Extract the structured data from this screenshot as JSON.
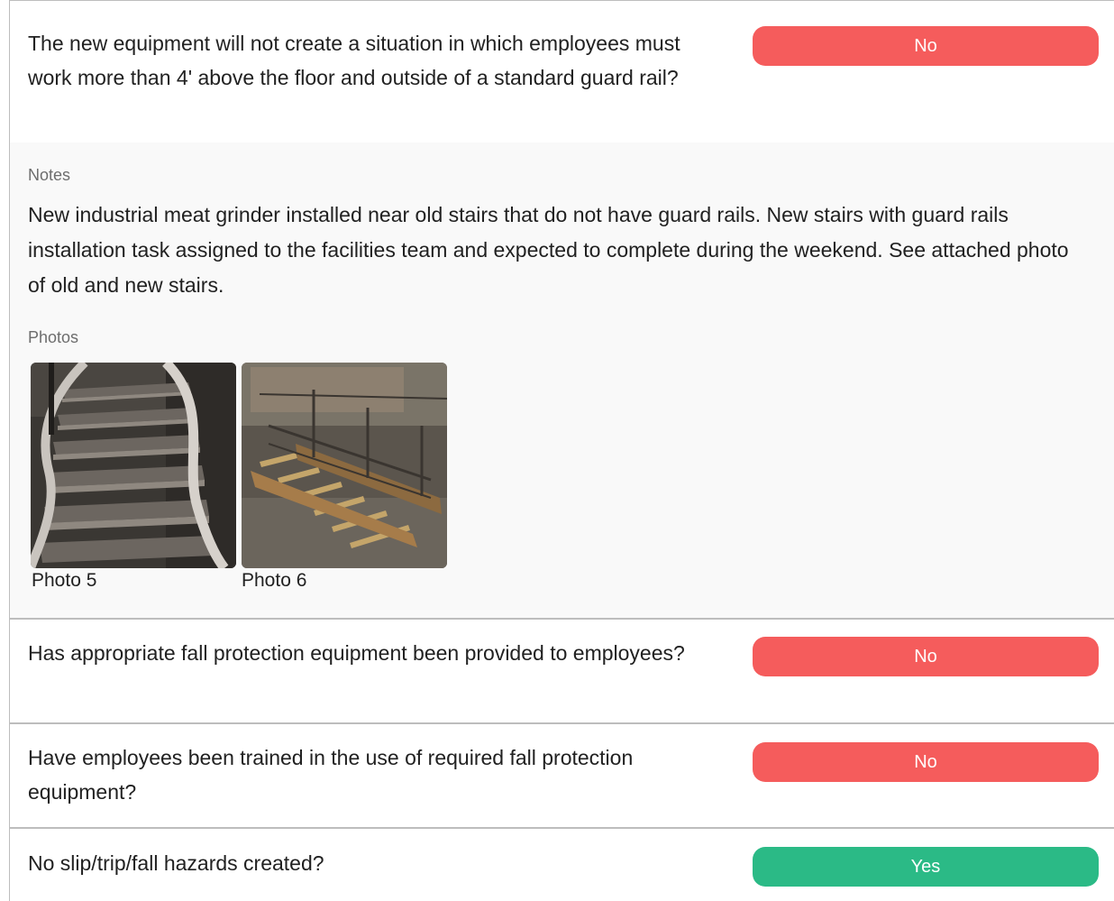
{
  "questions": [
    {
      "text": "The new equipment will not create a situation in which employees must work more than 4' above the floor and outside of a standard guard rail?",
      "answer": "No"
    },
    {
      "text": "Has appropriate fall protection equipment been provided to employees?",
      "answer": "No"
    },
    {
      "text": "Have employees been trained in the use of required fall protection equipment?",
      "answer": "No"
    },
    {
      "text": "No slip/trip/fall hazards created?",
      "answer": "Yes"
    }
  ],
  "notes": {
    "label": "Notes",
    "text": "New industrial meat grinder installed near old stairs that do not have guard rails. New stairs with guard rails installation task assigned to the facilities team and expected to complete during the weekend. See attached photo of old and new stairs."
  },
  "photos": {
    "label": "Photos",
    "items": [
      {
        "caption": "Photo 5"
      },
      {
        "caption": "Photo 6"
      }
    ]
  },
  "colors": {
    "no": "#f55c5c",
    "yes": "#2bba86"
  }
}
